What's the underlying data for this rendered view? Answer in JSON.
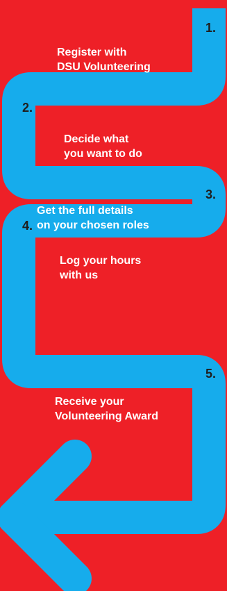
{
  "colors": {
    "background": "#ee2027",
    "path": "#16acec",
    "step_text": "#ffffff",
    "number_text": "#1f1f1f"
  },
  "steps": [
    {
      "number": "1.",
      "lines": [
        "Register with",
        "DSU Volunteering"
      ]
    },
    {
      "number": "2.",
      "lines": [
        "Decide what",
        "you want to do"
      ]
    },
    {
      "number": "3.",
      "lines": [
        "Get the full details",
        "on your chosen roles"
      ]
    },
    {
      "number": "4.",
      "lines": [
        "Log your hours",
        "with us"
      ]
    },
    {
      "number": "5.",
      "lines": [
        "Receive your",
        "Volunteering Award"
      ]
    }
  ]
}
